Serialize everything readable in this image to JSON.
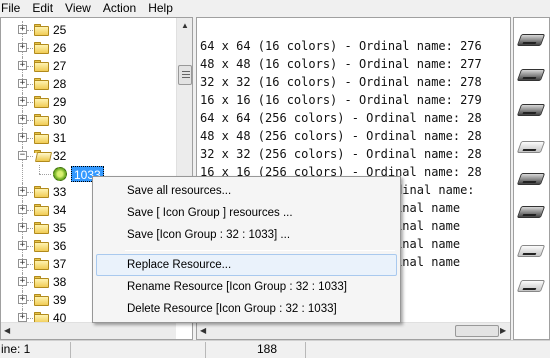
{
  "menubar": {
    "items": [
      "File",
      "Edit",
      "View",
      "Action",
      "Help"
    ]
  },
  "tree": {
    "items": [
      {
        "label": "25",
        "expanded": false
      },
      {
        "label": "26",
        "expanded": false
      },
      {
        "label": "27",
        "expanded": false
      },
      {
        "label": "28",
        "expanded": false
      },
      {
        "label": "29",
        "expanded": false
      },
      {
        "label": "30",
        "expanded": false
      },
      {
        "label": "31",
        "expanded": false
      },
      {
        "label": "32",
        "expanded": true
      },
      {
        "label": "1033",
        "selected": true,
        "child": true
      },
      {
        "label": "33",
        "expanded": false
      },
      {
        "label": "34",
        "expanded": false
      },
      {
        "label": "35",
        "expanded": false
      },
      {
        "label": "36",
        "expanded": false
      },
      {
        "label": "37",
        "expanded": false
      },
      {
        "label": "38",
        "expanded": false
      },
      {
        "label": "39",
        "expanded": false
      },
      {
        "label": "40",
        "expanded": false
      }
    ]
  },
  "text_pane": {
    "lines": [
      "64 x 64 (16 colors) - Ordinal name: 276",
      "48 x 48 (16 colors) - Ordinal name: 277",
      "32 x 32 (16 colors) - Ordinal name: 278",
      "16 x 16 (16 colors) - Ordinal name: 279",
      "64 x 64 (256 colors) - Ordinal name: 28",
      "48 x 48 (256 colors) - Ordinal name: 28",
      "32 x 32 (256 colors) - Ordinal name: 28",
      "16 x 16 (256 colors) - Ordinal name: 28",
      "0 x 0 (16.8mil colors) - Ordinal name:",
      "                      - Ordinal name",
      "                      - Ordinal name",
      "                      - Ordinal name",
      "                      - Ordinal name"
    ]
  },
  "icon_column": {
    "icons": [
      "hard-drive-icon",
      "hard-drive-icon",
      "hard-drive-icon",
      "network-drive-icon",
      "hard-drive-icon",
      "hard-drive-icon",
      "removable-drive-icon",
      "removable-drive-icon"
    ]
  },
  "context_menu": {
    "items": [
      {
        "label": "Save all resources..."
      },
      {
        "label": "Save [ Icon Group ] resources ..."
      },
      {
        "label": "Save [Icon Group : 32 : 1033] ..."
      },
      {
        "label": "Replace Resource...",
        "highlighted": true
      },
      {
        "label": "Rename Resource [Icon Group : 32 : 1033]"
      },
      {
        "label": "Delete Resource [Icon Group : 32 : 1033]"
      }
    ]
  },
  "status_bar": {
    "line": "ine: 1",
    "value": "188"
  }
}
